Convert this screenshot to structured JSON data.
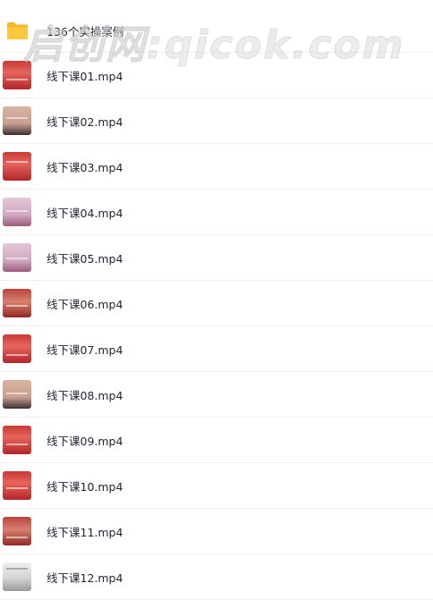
{
  "folder": {
    "name": "136个实操案例",
    "icon": "folder-icon"
  },
  "watermark": "启创网:qicok.com",
  "files": [
    {
      "name": "线下课01.mp4",
      "thumb": "red"
    },
    {
      "name": "线下课02.mp4",
      "thumb": "tan"
    },
    {
      "name": "线下课03.mp4",
      "thumb": "red"
    },
    {
      "name": "线下课04.mp4",
      "thumb": "purple"
    },
    {
      "name": "线下课05.mp4",
      "thumb": "purple"
    },
    {
      "name": "线下课06.mp4",
      "thumb": "brick"
    },
    {
      "name": "线下课07.mp4",
      "thumb": "red"
    },
    {
      "name": "线下课08.mp4",
      "thumb": "tan"
    },
    {
      "name": "线下课09.mp4",
      "thumb": "red"
    },
    {
      "name": "线下课10.mp4",
      "thumb": "red"
    },
    {
      "name": "线下课11.mp4",
      "thumb": "brick"
    },
    {
      "name": "线下课12.mp4",
      "thumb": "gray"
    }
  ]
}
